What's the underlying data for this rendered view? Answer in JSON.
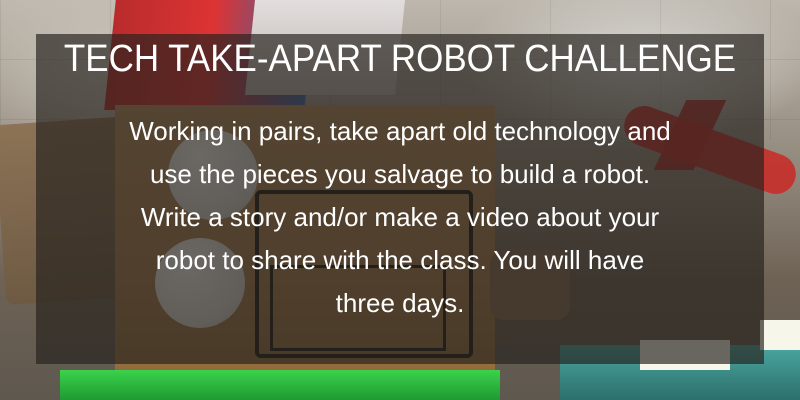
{
  "title": "TECH TAKE-APART ROBOT CHALLENGE",
  "body": "Working in pairs, take apart old technology and\nuse the pieces you salvage to build a robot.\nWrite a story and/or make a video about your\nrobot to share with the class.  You will have\nthree days.",
  "colors": {
    "overlay": "#26221e",
    "text": "#ffffff"
  }
}
